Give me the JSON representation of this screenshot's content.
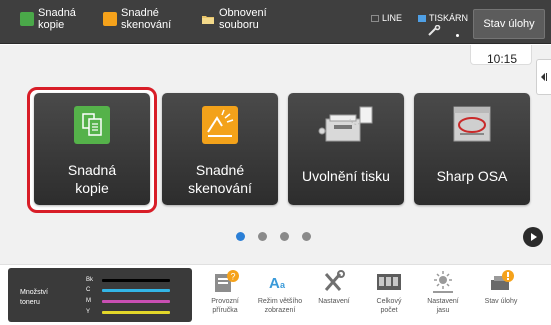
{
  "topbar": {
    "shortcuts": [
      {
        "label": "Snadná\nkopie",
        "icon": "copy-shortcut-icon",
        "color": "#4aa849"
      },
      {
        "label": "Snadné\nskenování",
        "icon": "scan-shortcut-icon",
        "color": "#f5a21b"
      },
      {
        "label": "Obnovení\nsouboru",
        "icon": "folder-icon"
      }
    ],
    "status_line": "LINE",
    "status_printer": "TISKÁRN",
    "status_button": "Stav úlohy"
  },
  "clock": "10:15",
  "tiles": [
    {
      "label": "Snadná\nkopie",
      "icon": "copy-icon",
      "selected": true
    },
    {
      "label": "Snadné\nskenování",
      "icon": "scan-icon"
    },
    {
      "label": "Uvolnění tisku",
      "icon": "printer-icon"
    },
    {
      "label": "Sharp OSA",
      "icon": "osa-icon"
    }
  ],
  "pagination": {
    "pages": 4,
    "current": 1
  },
  "toner": {
    "title": "Množství\ntoneru",
    "levels": [
      {
        "key": "Bk",
        "color": "#000000"
      },
      {
        "key": "C",
        "color": "#33b5e5"
      },
      {
        "key": "M",
        "color": "#c94fb3"
      },
      {
        "key": "Y",
        "color": "#e3d72a"
      }
    ]
  },
  "bottom_icons": [
    {
      "label": "Provozní\npříručka",
      "icon": "manual-icon"
    },
    {
      "label": "Režim většího\nzobrazení",
      "icon": "large-display-icon"
    },
    {
      "label": "Nastavení",
      "icon": "settings-tools-icon"
    },
    {
      "label": "Celkový\npočet",
      "icon": "counter-icon"
    },
    {
      "label": "Nastavení\njasu",
      "icon": "brightness-icon"
    },
    {
      "label": "Stav úlohy",
      "icon": "job-status-icon"
    }
  ],
  "colors": {
    "accent_blue": "#2b7fd6",
    "selection_red": "#d81d27",
    "topbar_bg": "#3f3f3f"
  }
}
